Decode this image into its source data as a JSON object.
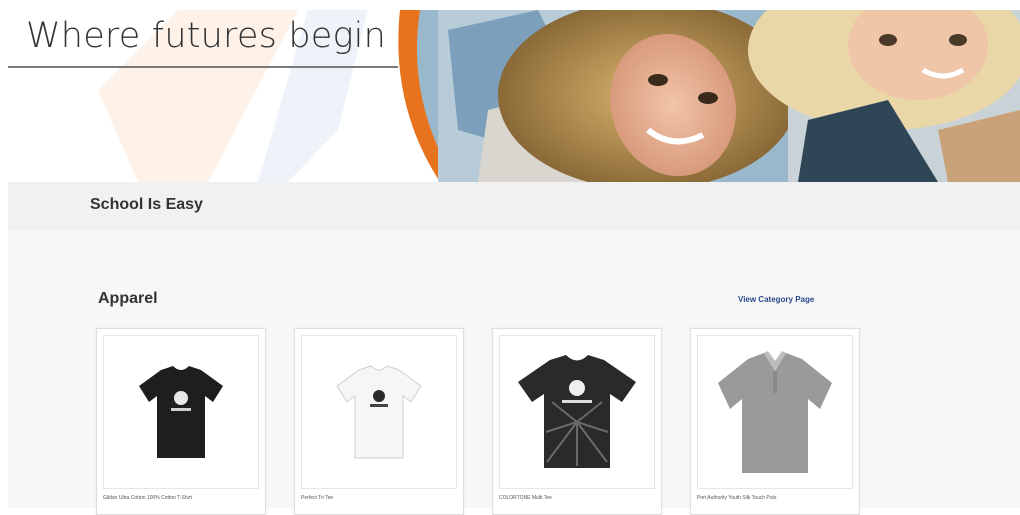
{
  "banner": {
    "title": "Where futures begin"
  },
  "store": {
    "title": "School Is Easy"
  },
  "category": {
    "title": "Apparel",
    "view_link": "View Category Page"
  },
  "products": [
    {
      "name": "Gildan Ultra Cotton 100% Cotton T-Shirt",
      "color": "#1e1e1e"
    },
    {
      "name": "Perfect Tri Tee",
      "color": "#f4f4f4"
    },
    {
      "name": "COLORTONE Multi Tee",
      "color": "#2a2a2a"
    },
    {
      "name": "Port Authority Youth Silk Touch Polo",
      "color": "#9a9a9a"
    }
  ]
}
